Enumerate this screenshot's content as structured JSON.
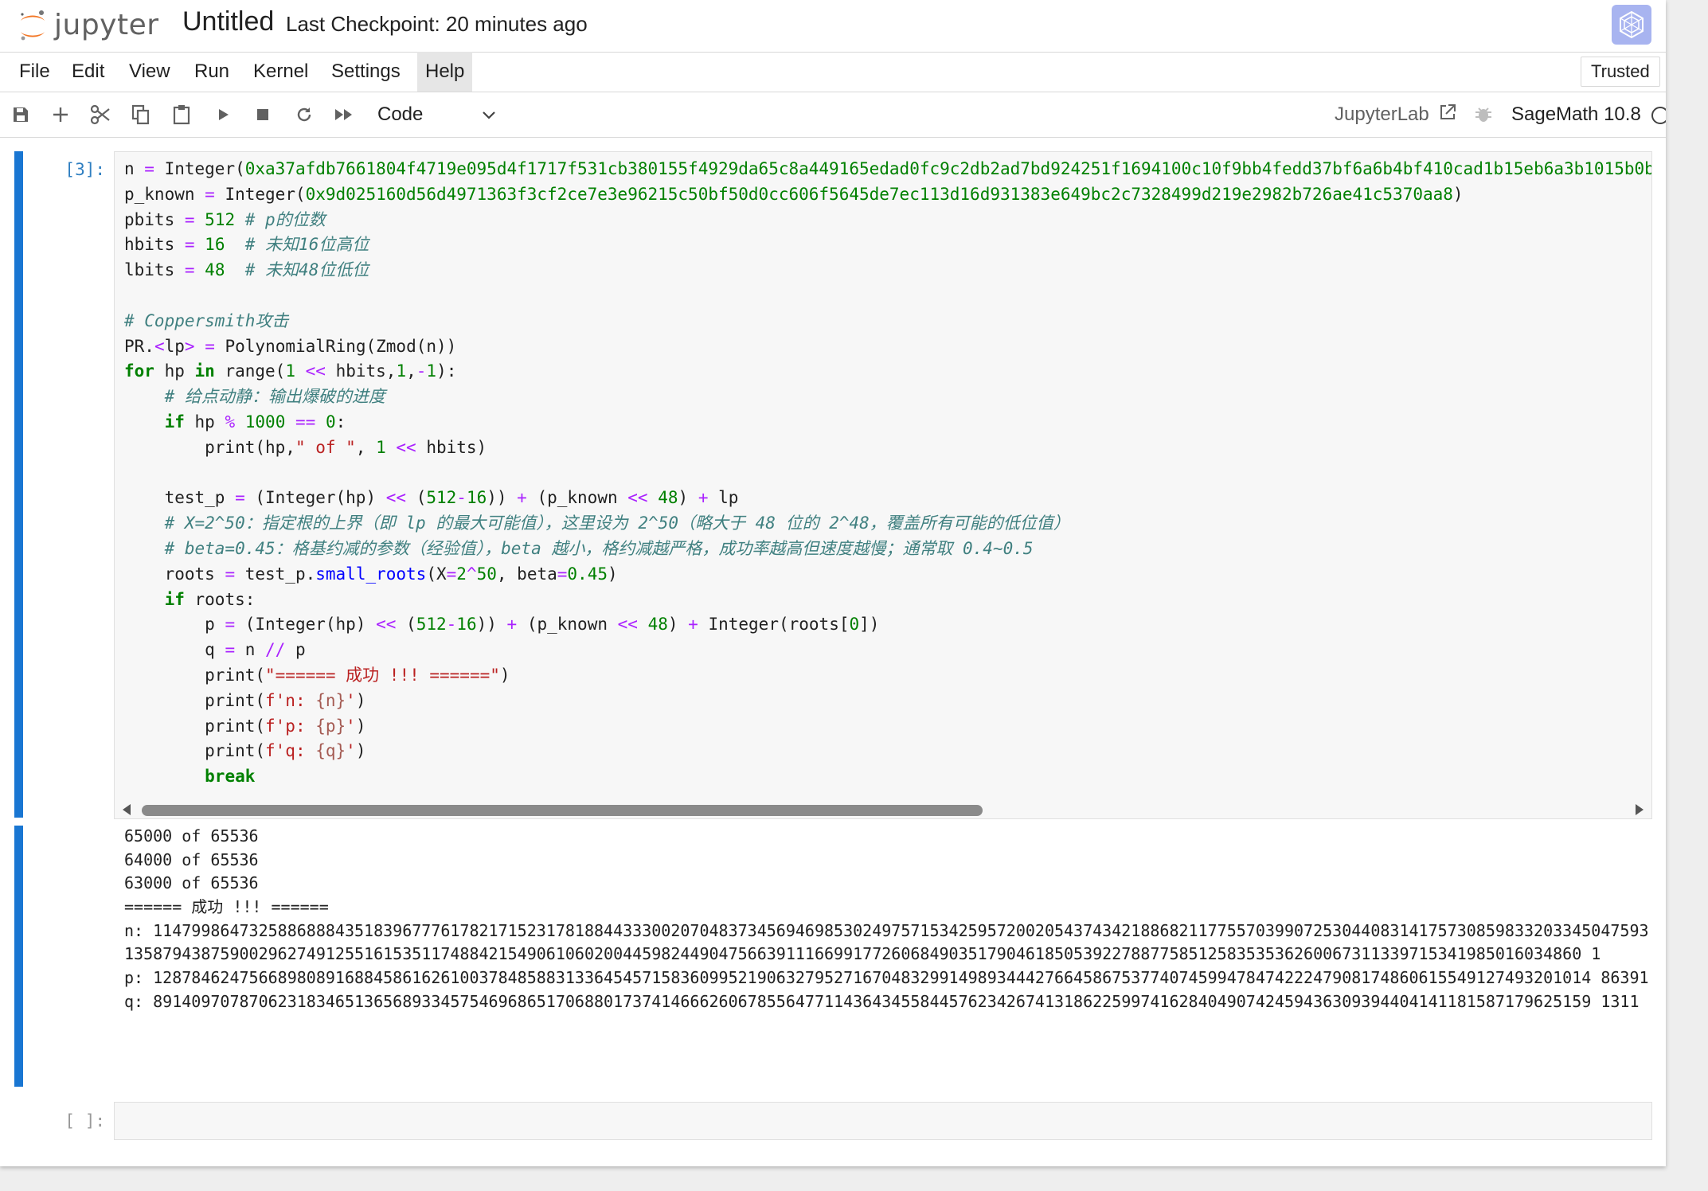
{
  "header": {
    "logo_text": "jupyter",
    "notebook_title": "Untitled",
    "checkpoint": "Last Checkpoint: 20 minutes ago"
  },
  "menubar": {
    "items": [
      "File",
      "Edit",
      "View",
      "Run",
      "Kernel",
      "Settings",
      "Help"
    ],
    "active": "Help",
    "trusted_label": "Trusted"
  },
  "toolbar": {
    "icons": [
      "save-icon",
      "add-cell-icon",
      "cut-icon",
      "copy-icon",
      "paste-icon",
      "run-icon",
      "stop-icon",
      "restart-icon",
      "run-all-icon"
    ],
    "cell_type": "Code",
    "jupyterlab_label": "JupyterLab",
    "kernel_name": "SageMath 10.8"
  },
  "cell1": {
    "prompt": "[3]:"
  },
  "output": {
    "lines": [
      "65000 of 65536",
      "64000 of 65536",
      "63000 of 65536",
      "====== 成功 !!! ======"
    ],
    "n": "n: 11479986473258868884351839677761782171523178188443330020704837345694698530249757153425957200205437434218868211775570399072530440831417573085983320334504759313587943875900296274912551615351174884215490610602004459824490475663911166991772606849035179046185053922788775851258353536260067311339715341985016034860 1",
    "p": "p: 128784624756689808916884586162610037848588313364545715836099521906327952716704832991498934442766458675377407459947847422247908174860615549127493201014 86391",
    "q": "q: 891409707870623183465136568933457546968651706880173741466626067855647711436434558445762342674131862259974162840490742459436309394404141181587179625159 1311"
  },
  "cell2": {
    "prompt": "[ ]:"
  }
}
